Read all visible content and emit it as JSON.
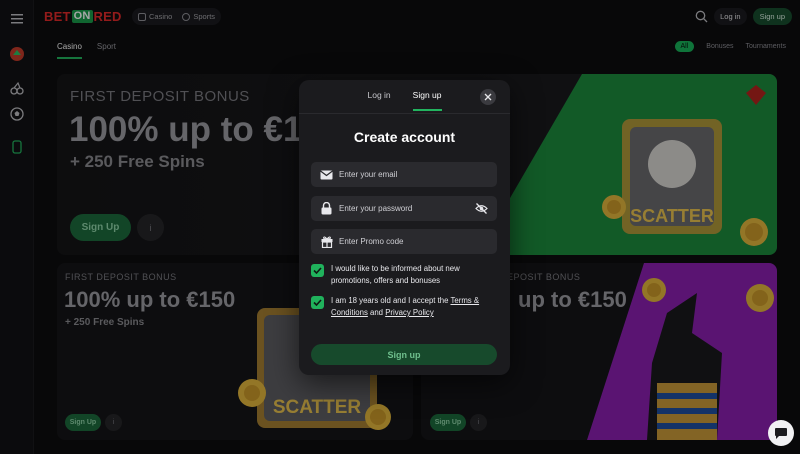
{
  "brand": {
    "bet": "BET",
    "on": "ON",
    "red": "RED"
  },
  "topnav": {
    "casino": "Casino",
    "sports": "Sports"
  },
  "header": {
    "login": "Log in",
    "signup": "Sign up"
  },
  "subtabs": {
    "casino": "Casino",
    "sport": "Sport"
  },
  "filters": {
    "all": "All",
    "bonuses": "Bonuses",
    "tournaments": "Tournaments"
  },
  "banner_main": {
    "eyebrow": "FIRST DEPOSIT BONUS",
    "headline": "100% up to €1",
    "sub": "+ 250 Free Spins",
    "cta": "Sign Up",
    "info": "i"
  },
  "banner_left": {
    "eyebrow": "FIRST DEPOSIT BONUS",
    "headline": "100% up to €150",
    "sub": "+ 250 Free Spins",
    "cta": "Sign Up",
    "info": "i"
  },
  "banner_right": {
    "eyebrow": "DEPOSIT BONUS",
    "headline": "up to €150",
    "cta": "Sign Up",
    "info": "i"
  },
  "modal": {
    "tab_login": "Log in",
    "tab_signup": "Sign up",
    "title": "Create account",
    "email_placeholder": "Enter your email",
    "password_placeholder": "Enter your password",
    "promo_placeholder": "Enter Promo code",
    "check1": "I would like to be informed about new promotions, offers and bonuses",
    "check2_pre": "I am 18 years old and I accept the ",
    "check2_terms": "Terms & Conditions",
    "check2_and": " and ",
    "check2_privacy": "Privacy Policy",
    "submit": "Sign up"
  },
  "colors": {
    "accent": "#22b45f",
    "brand_red": "#e22a2a",
    "modal_bg": "#1b1b1e"
  }
}
